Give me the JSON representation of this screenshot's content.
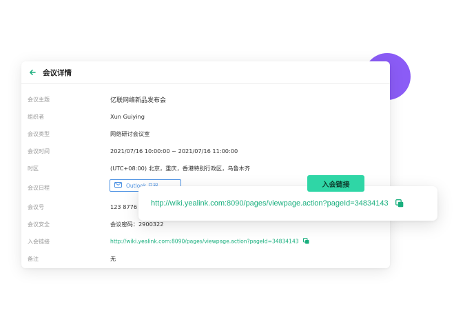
{
  "card": {
    "title": "会议详情"
  },
  "rows": [
    {
      "label": "会议主题",
      "value": "亿联网络新品发布会"
    },
    {
      "label": "组织者",
      "value": "Xun Guiying"
    },
    {
      "label": "会议类型",
      "value": "网络研讨会议室"
    },
    {
      "label": "会议时间",
      "value": "2021/07/16 10:00:00 ~ 2021/07/16 11:00:00"
    },
    {
      "label": "时区",
      "value": "(UTC+08:00) 北京，重庆，香港特别行政区，乌鲁木齐"
    },
    {
      "label": "会议日程",
      "value": "Outlook 日程"
    },
    {
      "label": "会议号",
      "value": "123 8776 7"
    },
    {
      "label": "会议安全",
      "value": "会议密码：2900322"
    },
    {
      "label": "入会链接",
      "value": "http://wiki.yealink.com:8090/pages/viewpage.action?pageId=34834143"
    },
    {
      "label": "备注",
      "value": "无"
    }
  ],
  "popup": {
    "badge": "入会链接",
    "link": "http://wiki.yealink.com:8090/pages/viewpage.action?pageId=34834143"
  },
  "colors": {
    "accent_green": "#1aaf7e",
    "badge_green": "#2fd6a6",
    "purple": "#8b5cf6",
    "outlook_blue": "#4a90e2"
  }
}
